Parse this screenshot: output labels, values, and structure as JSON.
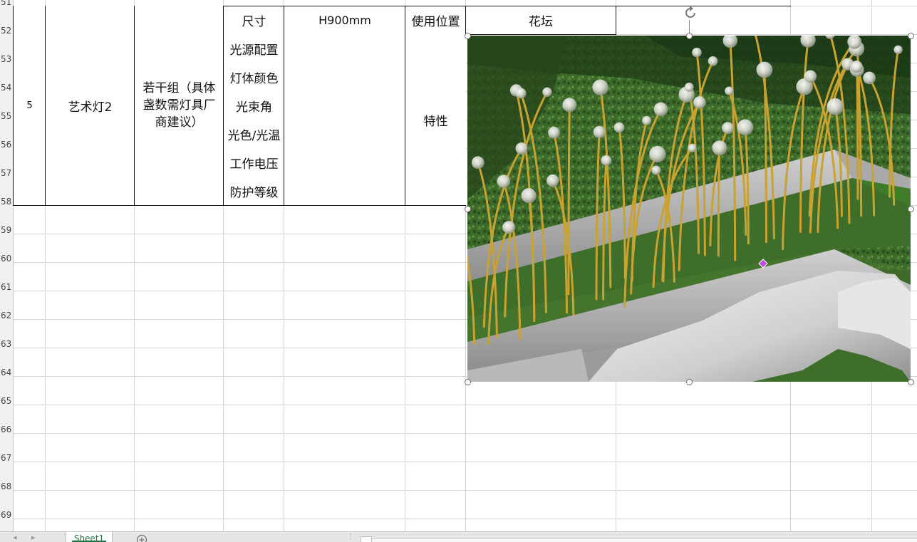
{
  "row_numbers": [
    "51",
    "52",
    "53",
    "54",
    "55",
    "56",
    "57",
    "58",
    "59",
    "60",
    "61",
    "62",
    "63",
    "64",
    "65",
    "66",
    "67",
    "68",
    "69"
  ],
  "table": {
    "index": "5",
    "item_name": "艺术灯2",
    "quantity": "若干组（具体盏数需灯具厂商建议）",
    "size_label": "尺寸",
    "size_value": "H900mm",
    "location_label": "使用位置",
    "location_value": "花坛",
    "characteristics_label": "特性",
    "spec_labels": [
      "光源配置",
      "灯体颜色",
      "光束角",
      "光色/光温",
      "工作电压",
      "防护等级"
    ],
    "spec_values": [
      "",
      "",
      "",
      "",
      "",
      ""
    ]
  },
  "tabs": {
    "active_sheet": "Sheet1",
    "new_sheet_icon": "plus-circle-icon"
  },
  "colors": {
    "accent": "#217346",
    "adjust_handle": "#c04ce0",
    "lawn": "#3f6d2a",
    "hedge": "#2c4d1e",
    "stem": "#c9a230"
  }
}
